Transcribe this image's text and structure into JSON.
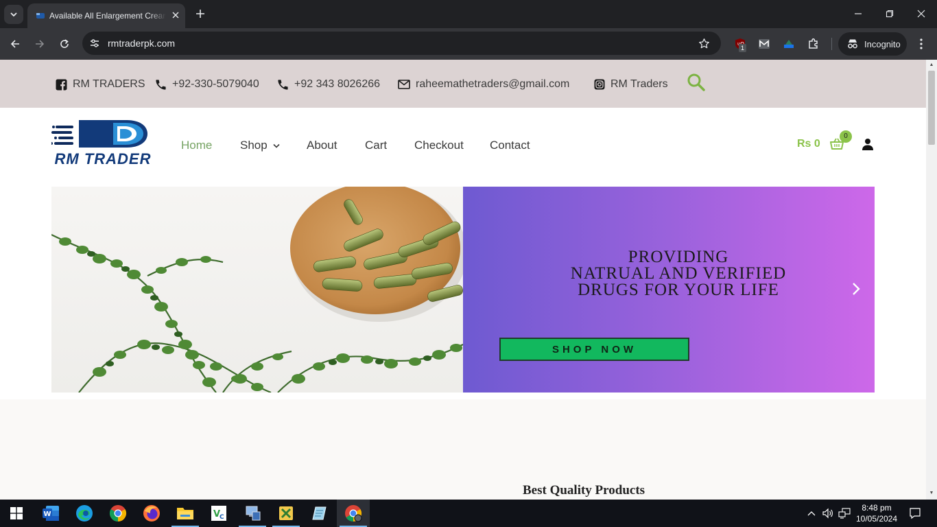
{
  "browser": {
    "tab_title": "Available All Enlargement Cream",
    "url": "rmtraderpk.com",
    "incognito_label": "Incognito",
    "extension_badge": "1"
  },
  "topbar": {
    "brand": "RM TRADERS",
    "phone1": "+92-330-5079040",
    "phone2": "+92 343 8026266",
    "email": "raheemathetraders@gmail.com",
    "instagram": "RM Traders"
  },
  "logo": {
    "text": "RM TRADER"
  },
  "nav": {
    "items": [
      {
        "label": "Home",
        "active": true
      },
      {
        "label": "Shop",
        "has_dropdown": true
      },
      {
        "label": "About"
      },
      {
        "label": "Cart"
      },
      {
        "label": "Checkout"
      },
      {
        "label": "Contact"
      }
    ]
  },
  "cart": {
    "total": "Rs 0",
    "count": "0"
  },
  "hero": {
    "line1": "PROVIDING",
    "line2": "NATRUAL AND VERIFIED",
    "line3": "DRUGS FOR YOUR LIFE",
    "button": "SHOP NOW"
  },
  "section": {
    "title": "Best Quality Products"
  },
  "taskbar": {
    "apps": [
      "start-icon",
      "word-icon",
      "edge-icon",
      "chrome-icon",
      "firefox-icon",
      "file-explorer-icon",
      "vnc-icon",
      "network-tool-icon",
      "tools-icon",
      "notepad-icon",
      "chrome-profile-icon"
    ],
    "time": "8:48 pm",
    "date": "10/05/2024"
  },
  "colors": {
    "accent_green": "#8bc34a",
    "nav_active": "#77a464",
    "topbar_bg": "#dcd3d3",
    "shop_button": "#12b85e"
  }
}
